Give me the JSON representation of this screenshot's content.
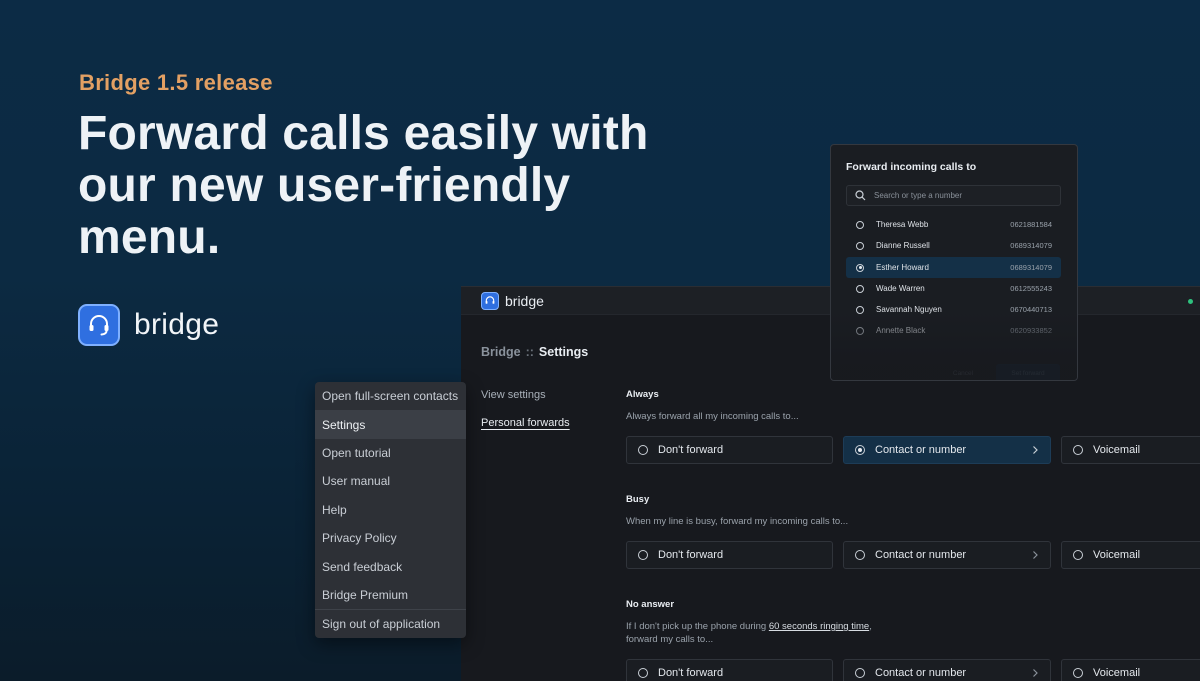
{
  "hero": {
    "eyebrow": "Bridge 1.5 release",
    "headline": "Forward calls easily with our new user-friendly menu.",
    "brand_name": "bridge"
  },
  "app": {
    "name": "bridge",
    "breadcrumb": {
      "parent": "Bridge",
      "separator": "::",
      "current": "Settings"
    },
    "sidebar": [
      {
        "label": "View settings",
        "active": false
      },
      {
        "label": "Personal forwards",
        "active": true
      }
    ],
    "sections": [
      {
        "title": "Always",
        "description": "Always forward all my incoming calls to...",
        "options": [
          {
            "label": "Don't forward",
            "selected": false
          },
          {
            "label": "Contact or number",
            "selected": true
          },
          {
            "label": "Voicemail",
            "selected": false
          }
        ]
      },
      {
        "title": "Busy",
        "description": "When my line is busy, forward my incoming calls to...",
        "options": [
          {
            "label": "Don't forward",
            "selected": false
          },
          {
            "label": "Contact or number",
            "selected": false
          },
          {
            "label": "Voicemail",
            "selected": false
          }
        ]
      },
      {
        "title": "No answer",
        "description_pre": "If I don't pick up the phone during ",
        "description_link": "60 seconds ringing time",
        "description_post": ",",
        "description_line2": "forward my calls to...",
        "options": [
          {
            "label": "Don't forward",
            "selected": false
          },
          {
            "label": "Contact or number",
            "selected": false
          },
          {
            "label": "Voicemail",
            "selected": false
          }
        ]
      }
    ]
  },
  "menu": {
    "items": [
      {
        "label": "Open full-screen contacts"
      },
      {
        "label": "Settings"
      },
      {
        "label": "Open tutorial"
      },
      {
        "label": "User manual"
      },
      {
        "label": "Help"
      },
      {
        "label": "Privacy Policy"
      },
      {
        "label": "Send feedback"
      },
      {
        "label": "Bridge Premium"
      },
      {
        "label": "Sign out of application"
      }
    ],
    "active_index": 1
  },
  "modal": {
    "title": "Forward incoming calls to",
    "search_placeholder": "Search or type a number",
    "contacts": [
      {
        "name": "Theresa Webb",
        "number": "0621881584",
        "selected": false
      },
      {
        "name": "Dianne Russell",
        "number": "0689314079",
        "selected": false
      },
      {
        "name": "Esther Howard",
        "number": "0689314079",
        "selected": true
      },
      {
        "name": "Wade Warren",
        "number": "0612555243",
        "selected": false
      },
      {
        "name": "Savannah Nguyen",
        "number": "0670440713",
        "selected": false
      },
      {
        "name": "Annette Black",
        "number": "0620933852",
        "selected": false
      }
    ],
    "cancel_label": "Cancel",
    "confirm_label": "Set forward"
  },
  "colors": {
    "accent": "#e3a063",
    "brand_blue": "#2f6fe0",
    "selected_bg": "#143047",
    "status_online": "#2ec27e"
  }
}
